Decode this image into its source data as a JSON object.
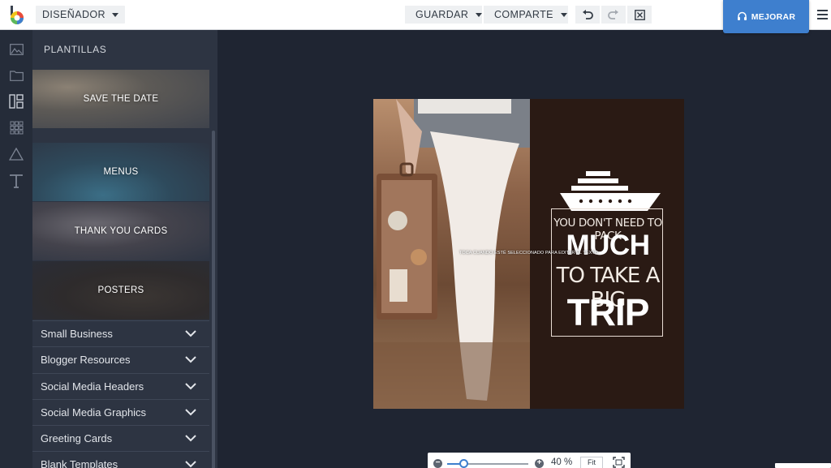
{
  "topbar": {
    "mode_label": "DISEÑADOR",
    "save_label": "GUARDAR",
    "share_label": "COMPARTE",
    "upgrade_label": "MEJORAR",
    "accent": "#3e7fce"
  },
  "rail": {
    "icons": [
      "image-icon",
      "folder-icon",
      "layout-icon",
      "grid-icon",
      "triangle-icon",
      "text-icon"
    ]
  },
  "panel": {
    "title": "PLANTILLAS",
    "tiles": [
      {
        "label": "SAVE THE DATE"
      },
      {
        "label": "MENUS"
      },
      {
        "label": "THANK YOU CARDS"
      },
      {
        "label": "POSTERS"
      }
    ],
    "categories": [
      {
        "label": "Small Business"
      },
      {
        "label": "Blogger Resources"
      },
      {
        "label": "Social Media Headers"
      },
      {
        "label": "Social Media Graphics"
      },
      {
        "label": "Greeting Cards"
      },
      {
        "label": "Blank Templates"
      }
    ]
  },
  "design": {
    "line1": "YOU DON'T NEED TO PACK",
    "line2": "MUCH",
    "line3": "TO TAKE A BIG",
    "line4": "TRIP",
    "tap_hint": "TOCA CUANDO ESTÉ SELECCIONADO PARA EDITAR EL TEXTO",
    "background": "#2a1a14"
  },
  "zoom": {
    "value_label": "40 %",
    "fit_label": "Fit",
    "level": 0.2
  }
}
